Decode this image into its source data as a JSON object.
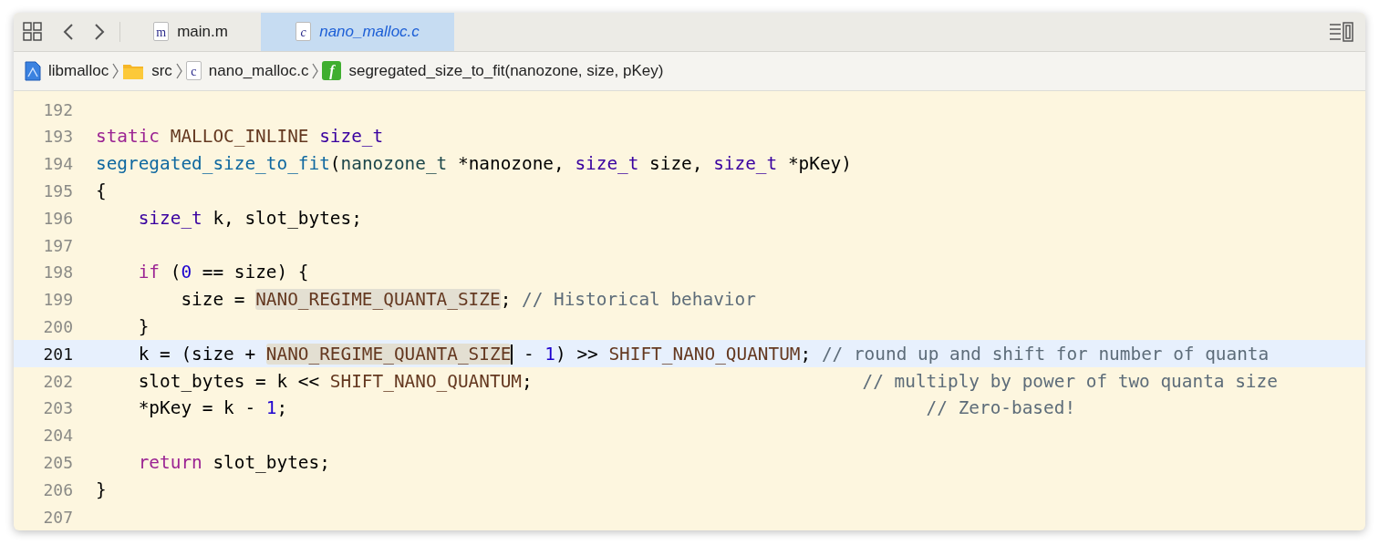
{
  "tabs": [
    {
      "label": "main.m",
      "icon_letter": "m",
      "selected": false
    },
    {
      "label": "nano_malloc.c",
      "icon_letter": "c",
      "selected": true
    }
  ],
  "breadcrumb": [
    {
      "kind": "project",
      "label": "libmalloc"
    },
    {
      "kind": "folder",
      "label": "src"
    },
    {
      "kind": "file",
      "label": "nano_malloc.c",
      "icon_letter": "c"
    },
    {
      "kind": "function",
      "label": "segregated_size_to_fit(nanozone, size, pKey)",
      "icon_letter": "f"
    }
  ],
  "lines": [
    {
      "number": "192",
      "current": false
    },
    {
      "number": "193",
      "current": false,
      "tokens": [
        {
          "kind": "keyword",
          "text": "static"
        },
        {
          "kind": "macro",
          "text": " MALLOC_INLINE"
        },
        {
          "kind": "type",
          "text": " size_t"
        }
      ]
    },
    {
      "number": "194",
      "current": false,
      "tokens": [
        {
          "kind": "function",
          "text": "segregated_size_to_fit"
        },
        {
          "kind": "plain",
          "text": "("
        },
        {
          "kind": "usertype",
          "text": "nanozone_t"
        },
        {
          "kind": "plain",
          "text": " *nanozone, "
        },
        {
          "kind": "type",
          "text": "size_t"
        },
        {
          "kind": "plain",
          "text": " size, "
        },
        {
          "kind": "type",
          "text": "size_t"
        },
        {
          "kind": "plain",
          "text": " *pKey)"
        }
      ]
    },
    {
      "number": "195",
      "current": false,
      "tokens": [
        {
          "kind": "plain",
          "text": "{"
        }
      ]
    },
    {
      "number": "196",
      "current": false,
      "tokens": [
        {
          "kind": "type",
          "text": "    size_t"
        },
        {
          "kind": "plain",
          "text": " k, slot_bytes;"
        }
      ]
    },
    {
      "number": "197",
      "current": false
    },
    {
      "number": "198",
      "current": false,
      "tokens": [
        {
          "kind": "keyword",
          "text": "    if"
        },
        {
          "kind": "plain",
          "text": " ("
        },
        {
          "kind": "number",
          "text": "0"
        },
        {
          "kind": "plain",
          "text": " == size) {"
        }
      ]
    },
    {
      "number": "199",
      "current": false,
      "tokens": [
        {
          "kind": "plain",
          "text": "        size = "
        },
        {
          "kind": "macro",
          "text": "NANO_REGIME_QUANTA_SIZE",
          "highlighted": true
        },
        {
          "kind": "plain",
          "text": "; "
        },
        {
          "kind": "comment",
          "text": "// Historical behavior"
        }
      ]
    },
    {
      "number": "200",
      "current": false,
      "tokens": [
        {
          "kind": "plain",
          "text": "    }"
        }
      ]
    },
    {
      "number": "201",
      "current": true,
      "tokens": [
        {
          "kind": "plain",
          "text": "    k = (size + "
        },
        {
          "kind": "macro",
          "text": "NANO_REGIME_QUANTA_SIZE",
          "highlighted": true,
          "caret_after": true
        },
        {
          "kind": "plain",
          "text": " - "
        },
        {
          "kind": "number",
          "text": "1"
        },
        {
          "kind": "plain",
          "text": ") >> "
        },
        {
          "kind": "macro",
          "text": "SHIFT_NANO_QUANTUM"
        },
        {
          "kind": "plain",
          "text": "; "
        },
        {
          "kind": "comment",
          "text": "// round up and shift for number of quanta"
        }
      ]
    },
    {
      "number": "202",
      "current": false,
      "tokens": [
        {
          "kind": "plain",
          "text": "    slot_bytes = k << "
        },
        {
          "kind": "macro",
          "text": "SHIFT_NANO_QUANTUM"
        },
        {
          "kind": "plain",
          "text": ";"
        },
        {
          "kind": "comment",
          "text": "                               // multiply by power of two quanta size"
        }
      ]
    },
    {
      "number": "203",
      "current": false,
      "tokens": [
        {
          "kind": "plain",
          "text": "    *pKey = k - "
        },
        {
          "kind": "number",
          "text": "1"
        },
        {
          "kind": "plain",
          "text": ";"
        },
        {
          "kind": "comment",
          "text": "                                                            // Zero-based!"
        }
      ]
    },
    {
      "number": "204",
      "current": false
    },
    {
      "number": "205",
      "current": false,
      "tokens": [
        {
          "kind": "keyword",
          "text": "    return"
        },
        {
          "kind": "plain",
          "text": " slot_bytes;"
        }
      ]
    },
    {
      "number": "206",
      "current": false,
      "tokens": [
        {
          "kind": "plain",
          "text": "}"
        }
      ]
    },
    {
      "number": "207",
      "current": false
    }
  ]
}
